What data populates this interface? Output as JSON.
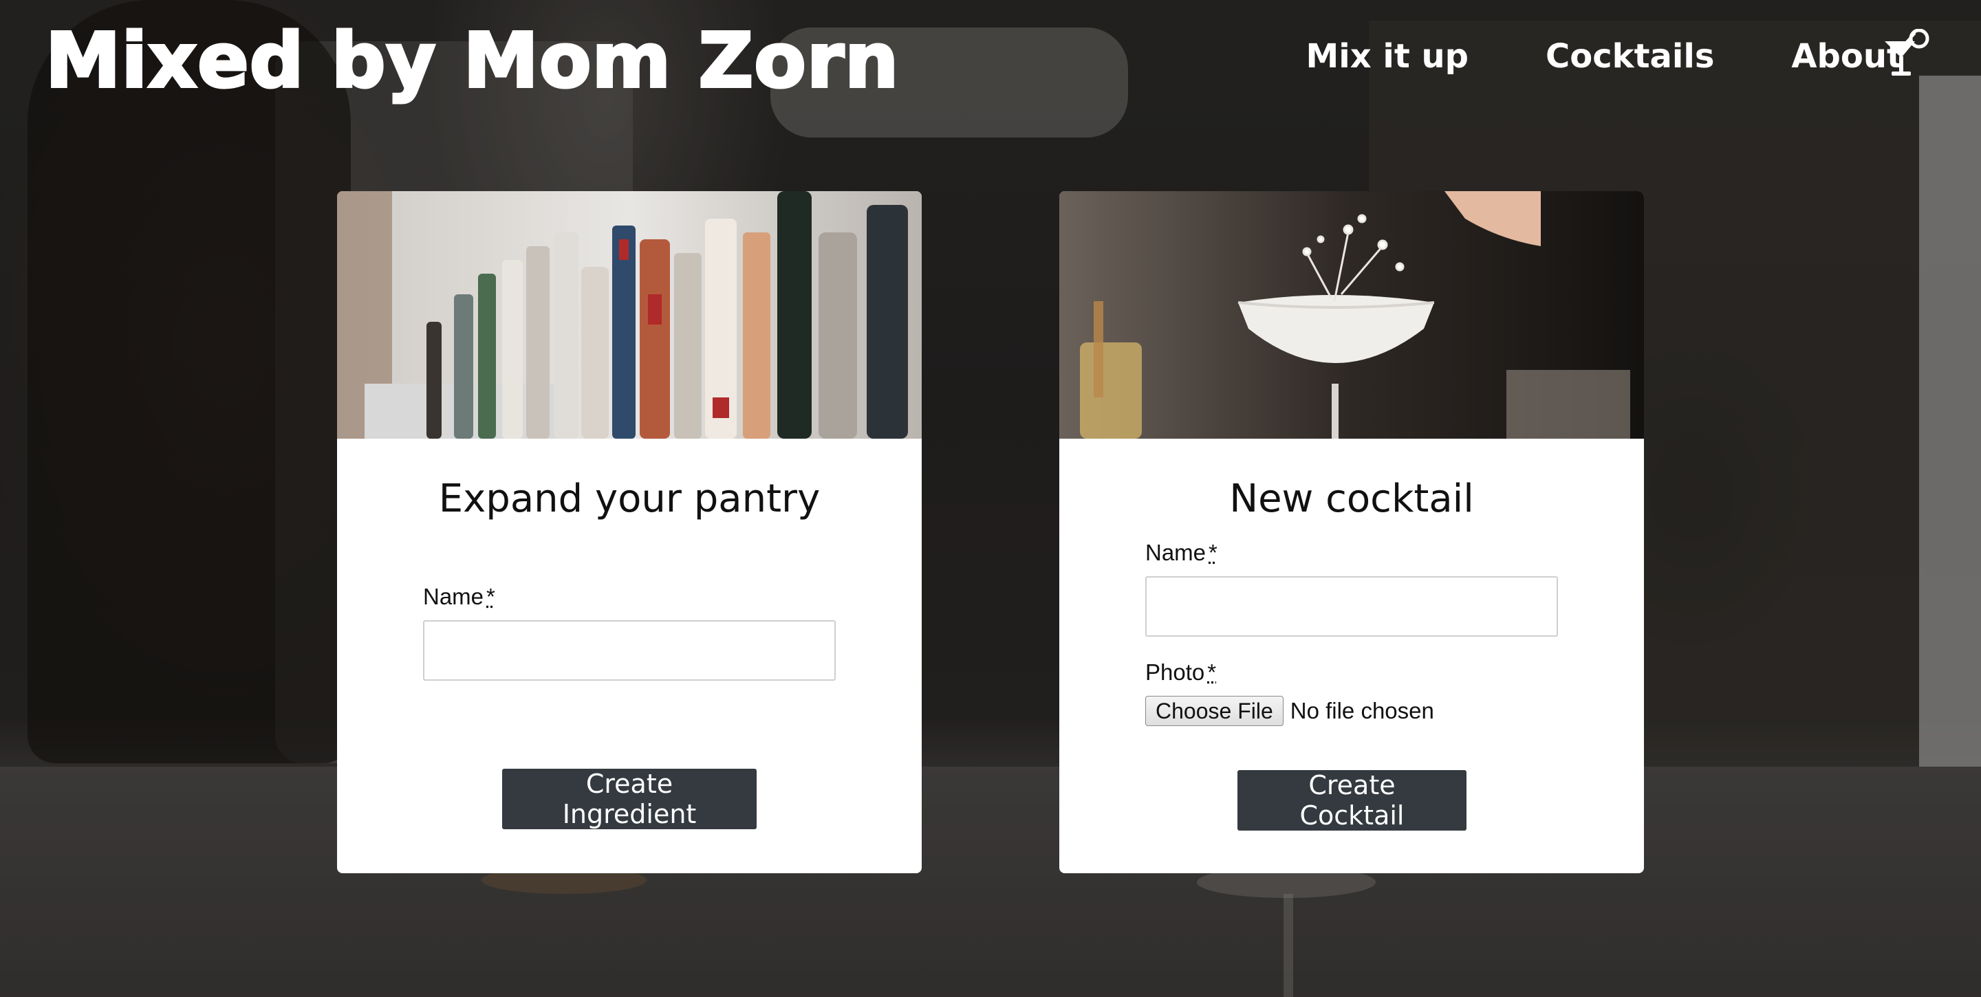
{
  "header": {
    "brand": "Mixed by Mom Zorn",
    "nav": [
      "Mix it up",
      "Cocktails",
      "About"
    ],
    "cocktail_icon": "cocktail-glass-icon"
  },
  "ingredient_card": {
    "image": "liquor-bottles-photo",
    "title": "Expand your pantry",
    "name_label": "Name",
    "required_marker": "*",
    "name_value": "",
    "submit_label": "Create Ingredient"
  },
  "cocktail_card": {
    "image": "cocktail-garnish-photo",
    "title": "New cocktail",
    "name_label": "Name",
    "required_marker": "*",
    "name_value": "",
    "photo_label": "Photo",
    "file_button_label": "Choose File",
    "file_status": "No file chosen",
    "submit_label": "Create Cocktail"
  },
  "colors": {
    "button_bg": "#343a40",
    "card_bg": "#ffffff",
    "header_text": "#ffffff"
  }
}
